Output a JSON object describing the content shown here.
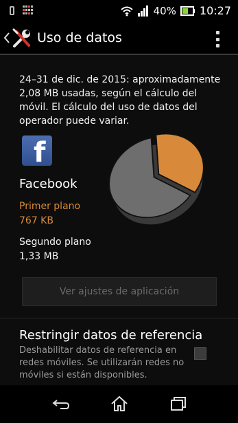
{
  "status_bar": {
    "battery": "40%",
    "time": "10:27"
  },
  "action_bar": {
    "title": "Uso de datos"
  },
  "summary": {
    "text": "24–31 de dic. de 2015: aproximadamente 2,08 MB usadas, según el cálculo del móvil. El cálculo del uso de datos del operador puede variar."
  },
  "app": {
    "name": "Facebook",
    "icon_letter": "f",
    "foreground_label": "Primer plano",
    "foreground_value": "767 KB",
    "background_label": "Segundo plano",
    "background_value": "1,33 MB"
  },
  "chart_data": {
    "type": "pie",
    "categories": [
      "Primer plano",
      "Segundo plano"
    ],
    "values": [
      767,
      1362
    ],
    "unit": "KB",
    "colors": [
      "#d88a3a",
      "#6e6e6e"
    ]
  },
  "app_settings_button": {
    "label": "Ver ajustes de aplicación"
  },
  "restrict": {
    "title": "Restringir datos de referencia",
    "description": "Deshabilitar datos de referencia en redes móviles. Se utilizarán redes no móviles si están disponibles.",
    "checked": false
  },
  "colors": {
    "accent_orange": "#d88a3a",
    "background": "#0d0d0d",
    "facebook_blue": "#3b5998"
  },
  "icons": {
    "back": "chevron-left-icon",
    "settings": "wrench-screwdriver-icon",
    "overflow": "overflow-menu-icon",
    "nav_back": "back-icon",
    "nav_home": "home-icon",
    "nav_recent": "recent-apps-icon"
  }
}
